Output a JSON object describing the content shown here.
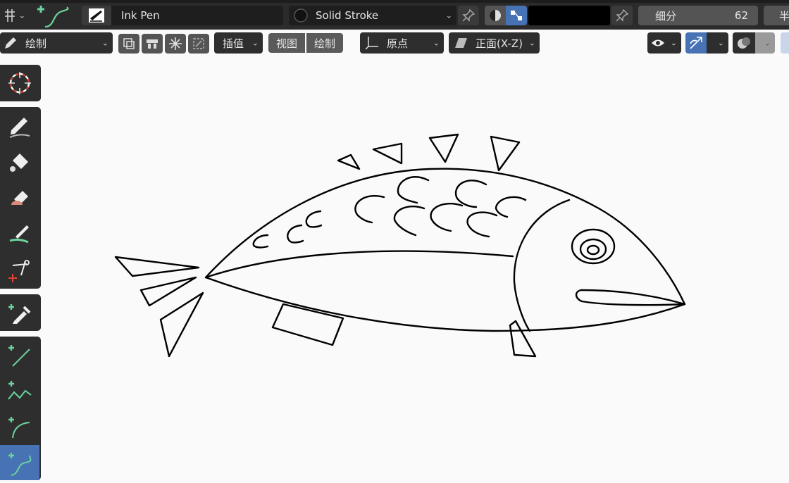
{
  "header": {
    "brush_name": "Ink Pen",
    "material_name": "Solid Stroke",
    "subdivide_label": "细分",
    "subdivide_value": "62",
    "cut_label": "半",
    "color": "#000000"
  },
  "toolbar2": {
    "mode_label": "绘制",
    "interpolate_label": "插值",
    "view_label": "视图",
    "draw_label": "绘制",
    "origin_label": "原点",
    "plane_label": "正面(X-Z)"
  },
  "tools": [
    {
      "name": "cursor-tool",
      "active": false
    },
    {
      "name": "draw-tool",
      "active": false
    },
    {
      "name": "fill-tool",
      "active": false
    },
    {
      "name": "erase-tool",
      "active": false
    },
    {
      "name": "tint-tool",
      "active": false
    },
    {
      "name": "cutter-tool",
      "active": false
    },
    {
      "name": "eyedropper-tool",
      "active": false
    },
    {
      "name": "line-tool",
      "active": false
    },
    {
      "name": "polyline-tool",
      "active": false
    },
    {
      "name": "arc-tool",
      "active": false
    },
    {
      "name": "curve-tool",
      "active": true
    }
  ],
  "colors": {
    "accent": "#4772b3",
    "header_bg": "#2b2b2b",
    "canvas_bg": "#fafafa",
    "stroke": "#000000"
  }
}
